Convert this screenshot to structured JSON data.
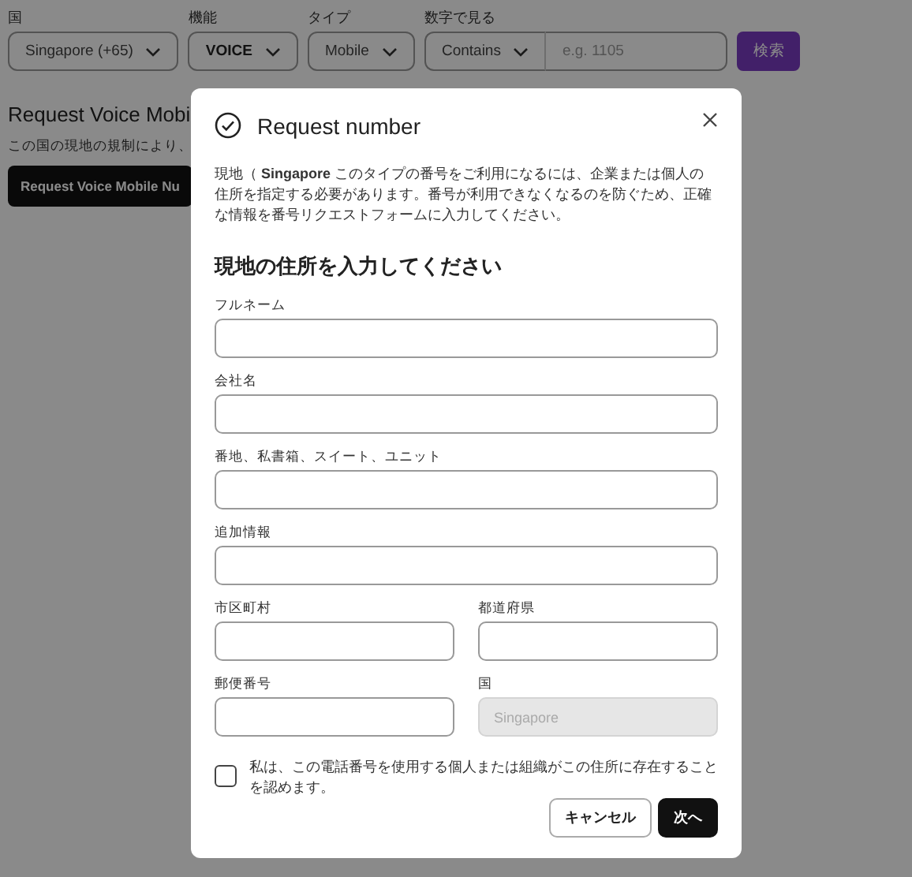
{
  "filters": [
    {
      "label": "国",
      "kind": "dropdown",
      "value": "Singapore (+65)",
      "emphasized": false
    },
    {
      "label": "機能",
      "kind": "dropdown",
      "value": "VOICE",
      "emphasized": true
    },
    {
      "label": "タイプ",
      "kind": "dropdown",
      "value": "Mobile",
      "emphasized": false
    },
    {
      "label": "数字で見る",
      "kind": "match",
      "value": "Contains",
      "placeholder": "e.g. 1105",
      "emphasized": false
    }
  ],
  "search_button": "検索",
  "section": {
    "title": "Request Voice Mobi",
    "note": "この国の現地の規制により、",
    "button": "Request Voice Mobile Nu"
  },
  "modal": {
    "title": "Request number",
    "intro": "現地（ **Singapore** このタイプの番号をご利用になるには、企業または個人の住所を指定する必要があります。番号が利用できなくなるのを防ぐため、正確な情報を番号リクエストフォームに入力してください。",
    "heading": "現地の住所を入力してください",
    "fields": [
      {
        "label": "フルネーム",
        "kind": "wide",
        "disabled": false
      },
      {
        "label": "会社名",
        "kind": "wide",
        "disabled": false
      },
      {
        "label": "番地、私書箱、スイート、ユニット",
        "kind": "wide",
        "disabled": false
      },
      {
        "label": "追加情報",
        "kind": "wide",
        "disabled": false
      },
      {
        "label": "市区町村",
        "kind": "half",
        "disabled": false
      },
      {
        "label": "都道府県",
        "kind": "half",
        "disabled": false
      },
      {
        "label": "郵便番号",
        "kind": "half",
        "disabled": false
      },
      {
        "label": "国",
        "kind": "half",
        "placeholder": "Singapore",
        "disabled": true
      }
    ],
    "confirm": {
      "label": "私は、この電話番号を使用する個人または組織がこの住所に存在することを認めます。",
      "checked": false
    },
    "buttons": [
      {
        "label": "キャンセル",
        "kind": "secondary"
      },
      {
        "label": "次へ",
        "kind": "primary"
      }
    ]
  }
}
